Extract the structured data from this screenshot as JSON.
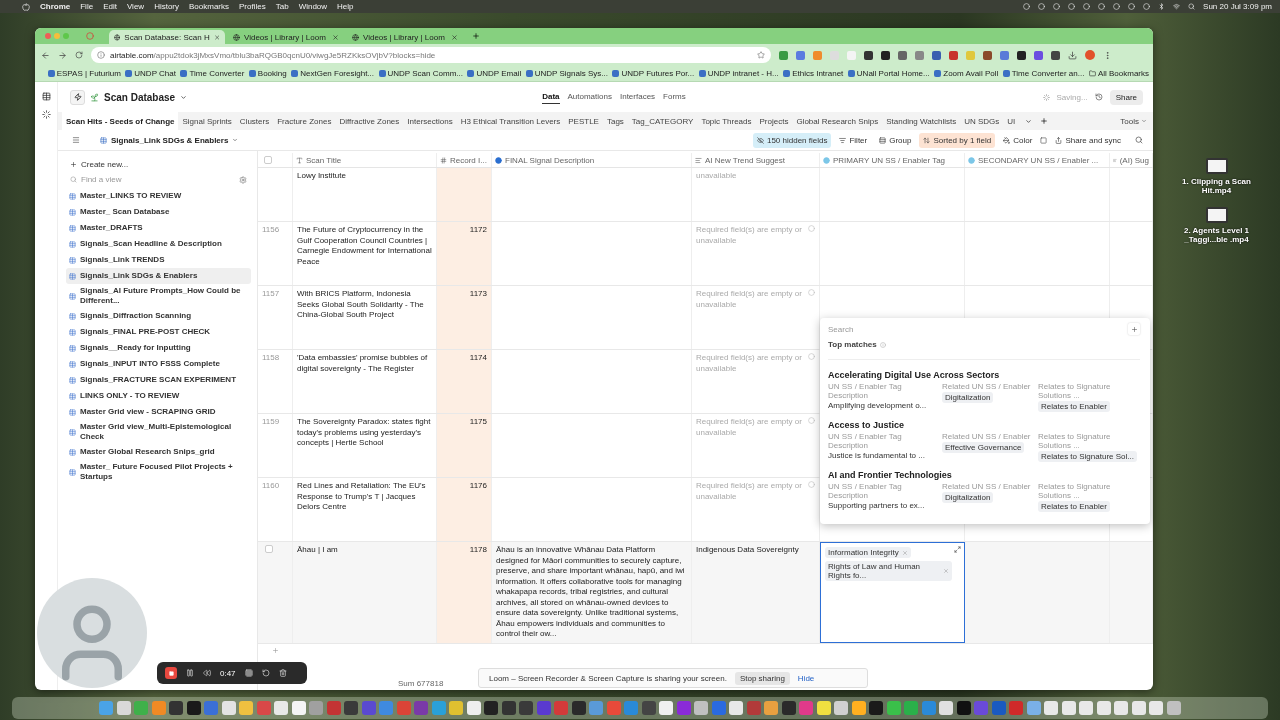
{
  "menubar": {
    "app": "Chrome",
    "items": [
      "File",
      "Edit",
      "View",
      "History",
      "Bookmarks",
      "Profiles",
      "Tab",
      "Window",
      "Help"
    ],
    "clock": "Sun 20 Jul 3:09 pm"
  },
  "browser": {
    "tabs": [
      {
        "title": "Scan Database: Scan H",
        "selected": true
      },
      {
        "title": "Videos | Library | Loom",
        "selected": false
      },
      {
        "title": "Videos | Library | Loom",
        "selected": false
      }
    ],
    "url_host": "airtable.com",
    "url_path": "/appu2tdok3jMxsVmo/tblu3baRQGB0qcnU0/viwgJe5RZKksOVjbV?blocks=hide",
    "bookmarks": [
      "ESPAS | Futurium",
      "UNDP Chat",
      "Time Converter",
      "Booking",
      "NextGen Foresight...",
      "UNDP Scan Comm...",
      "UNDP Email",
      "UNDP Signals Sys...",
      "UNDP Futures Por...",
      "UNDP intranet - H...",
      "Ethics Intranet",
      "UNall Portal Home...",
      "Zoom Avail Poll",
      "Time Converter an..."
    ],
    "all_bookmarks": "All Bookmarks"
  },
  "app": {
    "base_name": "Scan Database",
    "nav": [
      {
        "label": "Data",
        "selected": true
      },
      {
        "label": "Automations",
        "selected": false
      },
      {
        "label": "Interfaces",
        "selected": false
      },
      {
        "label": "Forms",
        "selected": false
      }
    ],
    "saving": "Saving...",
    "share": "Share"
  },
  "tables": [
    {
      "label": "Scan Hits - Seeds of Change",
      "selected": true
    },
    {
      "label": "Signal Sprints",
      "selected": false
    },
    {
      "label": "Clusters",
      "selected": false
    },
    {
      "label": "Fracture Zones",
      "selected": false
    },
    {
      "label": "Diffractive Zones",
      "selected": false
    },
    {
      "label": "Intersections",
      "selected": false
    },
    {
      "label": "H3 Ethical Transition Levers",
      "selected": false
    },
    {
      "label": "PESTLE",
      "selected": false
    },
    {
      "label": "Tags",
      "selected": false
    },
    {
      "label": "Tag_CATEGORY",
      "selected": false
    },
    {
      "label": "Topic Threads",
      "selected": false
    },
    {
      "label": "Projects",
      "selected": false
    },
    {
      "label": "Global Research Snips",
      "selected": false
    },
    {
      "label": "Standing Watchlists",
      "selected": false
    },
    {
      "label": "UN SDGs",
      "selected": false
    },
    {
      "label": "UI",
      "selected": false
    }
  ],
  "tools": "Tools",
  "view_bar": {
    "view_name": "Signals_Link SDGs & Enablers",
    "hidden_fields": "150 hidden fields",
    "filter": "Filter",
    "group": "Group",
    "sort": "Sorted by 1 field",
    "color_label": "Color",
    "share_sync": "Share and sync"
  },
  "sidebar": {
    "create": "Create new...",
    "search_placeholder": "Find a view",
    "views": [
      {
        "label": "Master_LINKS TO REVIEW",
        "selected": false
      },
      {
        "label": "Master_ Scan Database",
        "selected": false
      },
      {
        "label": "Master_DRAFTS",
        "selected": false
      },
      {
        "label": "Signals_Scan Headline & Description",
        "selected": false
      },
      {
        "label": "Signals_Link TRENDS",
        "selected": false
      },
      {
        "label": "Signals_Link SDGs & Enablers",
        "selected": true
      },
      {
        "label": "Signals_AI Future Prompts_How Could be Different...",
        "selected": false
      },
      {
        "label": "Signals_Diffraction Scanning",
        "selected": false
      },
      {
        "label": "Signals_FINAL PRE-POST CHECK",
        "selected": false
      },
      {
        "label": "Signals__Ready for Inputting",
        "selected": false
      },
      {
        "label": "Signals_INPUT INTO FSSS Complete",
        "selected": false
      },
      {
        "label": "Signals_FRACTURE SCAN EXPERIMENT",
        "selected": false
      },
      {
        "label": "LINKS ONLY - TO REVIEW",
        "selected": false
      },
      {
        "label": "Master Grid view - SCRAPING GRID",
        "selected": false
      },
      {
        "label": "Master Grid view_Multi-Epistemological Check",
        "selected": false
      },
      {
        "label": "Master Global Research Snips_grid",
        "selected": false
      },
      {
        "label": "Master_ Future Focused Pilot Projects + Startups",
        "selected": false
      }
    ]
  },
  "grid": {
    "columns": [
      "Scan Title",
      "Record I...",
      "FINAL Signal Description",
      "AI New Trend Suggest",
      "PRIMARY UN SS / Enabler Tag",
      "SECONDARY UN SS / Enabler ...",
      "(AI) Sug"
    ],
    "rows": [
      {
        "title": "Lowy Institute",
        "trend": {
          "kind": "note",
          "text": "unavailable"
        },
        "active": false
      },
      {
        "number": "1156",
        "title": "The Future of Cryptocurrency in the Gulf Cooperation Council Countries | Carnegie Endowment for International Peace",
        "record": "1172",
        "trend": {
          "kind": "error",
          "text": "Required field(s) are empty or unavailable"
        },
        "active": false
      },
      {
        "number": "1157",
        "title": "With BRICS Platform, Indonesia Seeks Global South Solidarity - The China-Global South Project",
        "record": "1173",
        "trend": {
          "kind": "error",
          "text": "Required field(s) are empty or unavailable"
        },
        "active": false
      },
      {
        "number": "1158",
        "title": "'Data embassies' promise bubbles of digital sovereignty - The Register",
        "record": "1174",
        "trend": {
          "kind": "error",
          "text": "Required field(s) are empty or unavailable"
        },
        "active": false
      },
      {
        "number": "1159",
        "title": "The Sovereignty Paradox: states fight today's problems using yesterday's concepts | Hertie School",
        "record": "1175",
        "trend": {
          "kind": "error",
          "text": "Required field(s) are empty or unavailable"
        },
        "active": false
      },
      {
        "number": "1160",
        "title": "Red Lines and Retaliation: The EU's Response to Trump's T | Jacques Delors Centre",
        "record": "1176",
        "trend": {
          "kind": "error",
          "text": "Required field(s) are empty or unavailable"
        },
        "active": false
      },
      {
        "title": "Āhau | I am",
        "record": "1178",
        "description": "Āhau is an innovative Whānau Data Platform designed for Māori communities to securely capture, preserve, and share important whānau, hapū, and iwi information. It offers collaborative tools for managing whakapapa records, tribal registries, and cultural archives, all stored on whānau-owned devices to ensure data sovereignty. Unlike traditional systems, Āhau empowers individuals and communities to control their ow...",
        "trend": {
          "kind": "value",
          "text": "Indigenous Data Sovereignty"
        },
        "primary_tags": [
          "Information Integrity",
          "Rights of Law and Human Rights fo..."
        ],
        "active": true
      }
    ],
    "sum": "Sum 677818",
    "select_all": false
  },
  "dropdown": {
    "placeholder": "Search",
    "section": "Top matches",
    "items": [
      {
        "title": "Accelerating Digital Use Across Sectors",
        "fields": [
          {
            "label": "UN SS / Enabler Tag Description",
            "value": "Amplifying development o...",
            "kind": "text"
          },
          {
            "label": "Related UN SS / Enabler",
            "value": "Digitalization",
            "kind": "tag"
          },
          {
            "label": "Relates to Signature Solutions ...",
            "value": "Relates to Enabler",
            "kind": "tag"
          }
        ]
      },
      {
        "title": "Access to Justice",
        "fields": [
          {
            "label": "UN SS / Enabler Tag Description",
            "value": "Justice is fundamental to ...",
            "kind": "text"
          },
          {
            "label": "Related UN SS / Enabler",
            "value": "Effective Governance",
            "kind": "tag"
          },
          {
            "label": "Relates to Signature Solutions ...",
            "value": "Relates to Signature Sol...",
            "kind": "tag"
          }
        ]
      },
      {
        "title": "AI and Frontier Technologies",
        "fields": [
          {
            "label": "UN SS / Enabler Tag Description",
            "value": "Supporting partners to ex...",
            "kind": "text"
          },
          {
            "label": "Related UN SS / Enabler",
            "value": "Digitalization",
            "kind": "tag"
          },
          {
            "label": "Relates to Signature Solutions ...",
            "value": "Relates to Enabler",
            "kind": "tag"
          }
        ]
      }
    ]
  },
  "desktop_files": [
    "1. Clipping a Scan Hit.mp4",
    "2. Agents Level 1 _Taggi...ble .mp4"
  ],
  "loom": {
    "timer": "0:47",
    "message": "Loom – Screen Recorder & Screen Capture is sharing your screen.",
    "stop": "Stop sharing",
    "hide": "Hide"
  }
}
